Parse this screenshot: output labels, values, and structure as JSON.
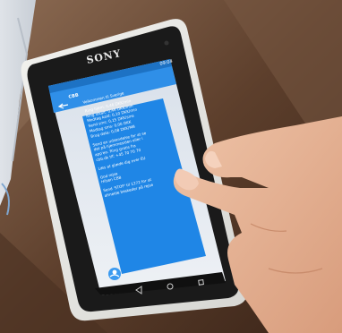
{
  "phone": {
    "brand": "SONY",
    "status_time": "09:04",
    "header_title": "CBB"
  },
  "message": {
    "lines": [
      "Velkommen til Sverige",
      "",
      "Ring hjem: 0,46 DKK/min",
      "Ring lokalt: 0,46 DKK/min",
      "Modtag kald: 0,10 DKK/min",
      "Send sms: 0,15 DKK/sms",
      "Modtag sms: 0,00 DKK",
      "Brug data: 0,08 DKK/MB",
      "",
      "Send en udsendelse for at se",
      "det på hjemmesiden eller i",
      "app'en. Ring gratis fra",
      "cbb.dk tlf: +45 70 70 70",
      "",
      "Læs at glæde dig over EU",
      "",
      "God rejse",
      "Hilsen CBB",
      "",
      "Send 'STOP' til 1272 for at",
      "afmelde beskeder på rejse"
    ]
  },
  "colors": {
    "accent_blue": "#2f8fe8",
    "chat_bubble": "#1f86e6"
  },
  "icons": [
    "back-arrow-icon",
    "nav-back-icon",
    "nav-home-icon",
    "nav-recents-icon",
    "avatar-icon",
    "signal-icon",
    "battery-icon"
  ]
}
